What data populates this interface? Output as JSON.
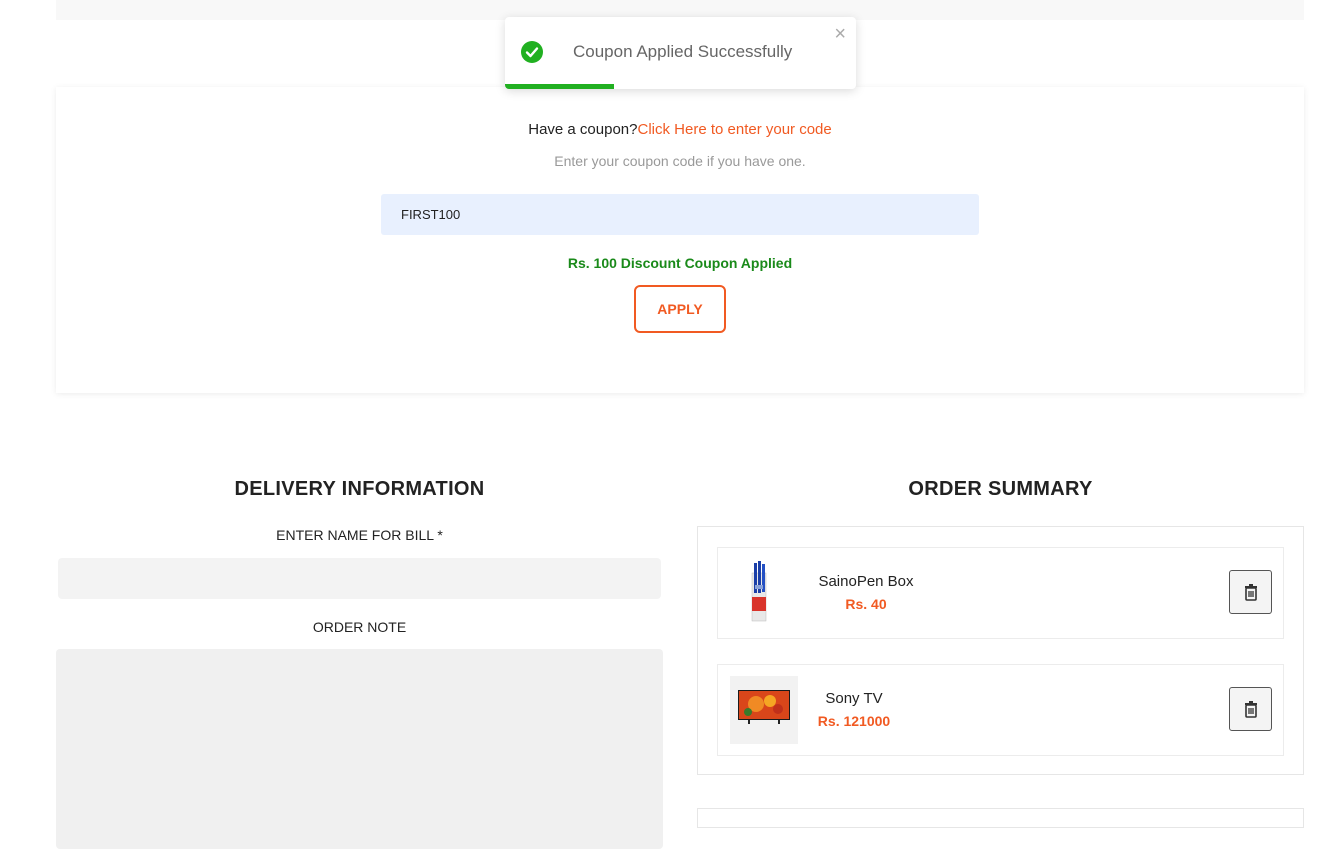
{
  "toast": {
    "message": "Coupon Applied Successfully",
    "close_glyph": "×",
    "progress_fraction": 0.31,
    "success_color": "#21b021",
    "icon": "check-circle-icon"
  },
  "coupon": {
    "prompt": "Have a coupon?",
    "link_text": "Click Here to enter your code",
    "subtext": "Enter your coupon code if you have one.",
    "code_value": "FIRST100",
    "success_message": "Rs. 100 Discount Coupon Applied",
    "apply_label": "APPLY",
    "accent_color": "#f15a22"
  },
  "delivery": {
    "title": "DELIVERY INFORMATION",
    "name_label": "ENTER NAME FOR BILL *",
    "name_value": "",
    "note_label": "ORDER NOTE",
    "note_value": ""
  },
  "summary": {
    "title": "ORDER SUMMARY",
    "items": [
      {
        "name": "SainoPen Box",
        "price": "Rs. 40",
        "thumb_icon": "pen-box-image"
      },
      {
        "name": "Sony TV",
        "price": "Rs. 121000",
        "thumb_icon": "tv-image"
      }
    ],
    "delete_icon": "trash-icon"
  }
}
